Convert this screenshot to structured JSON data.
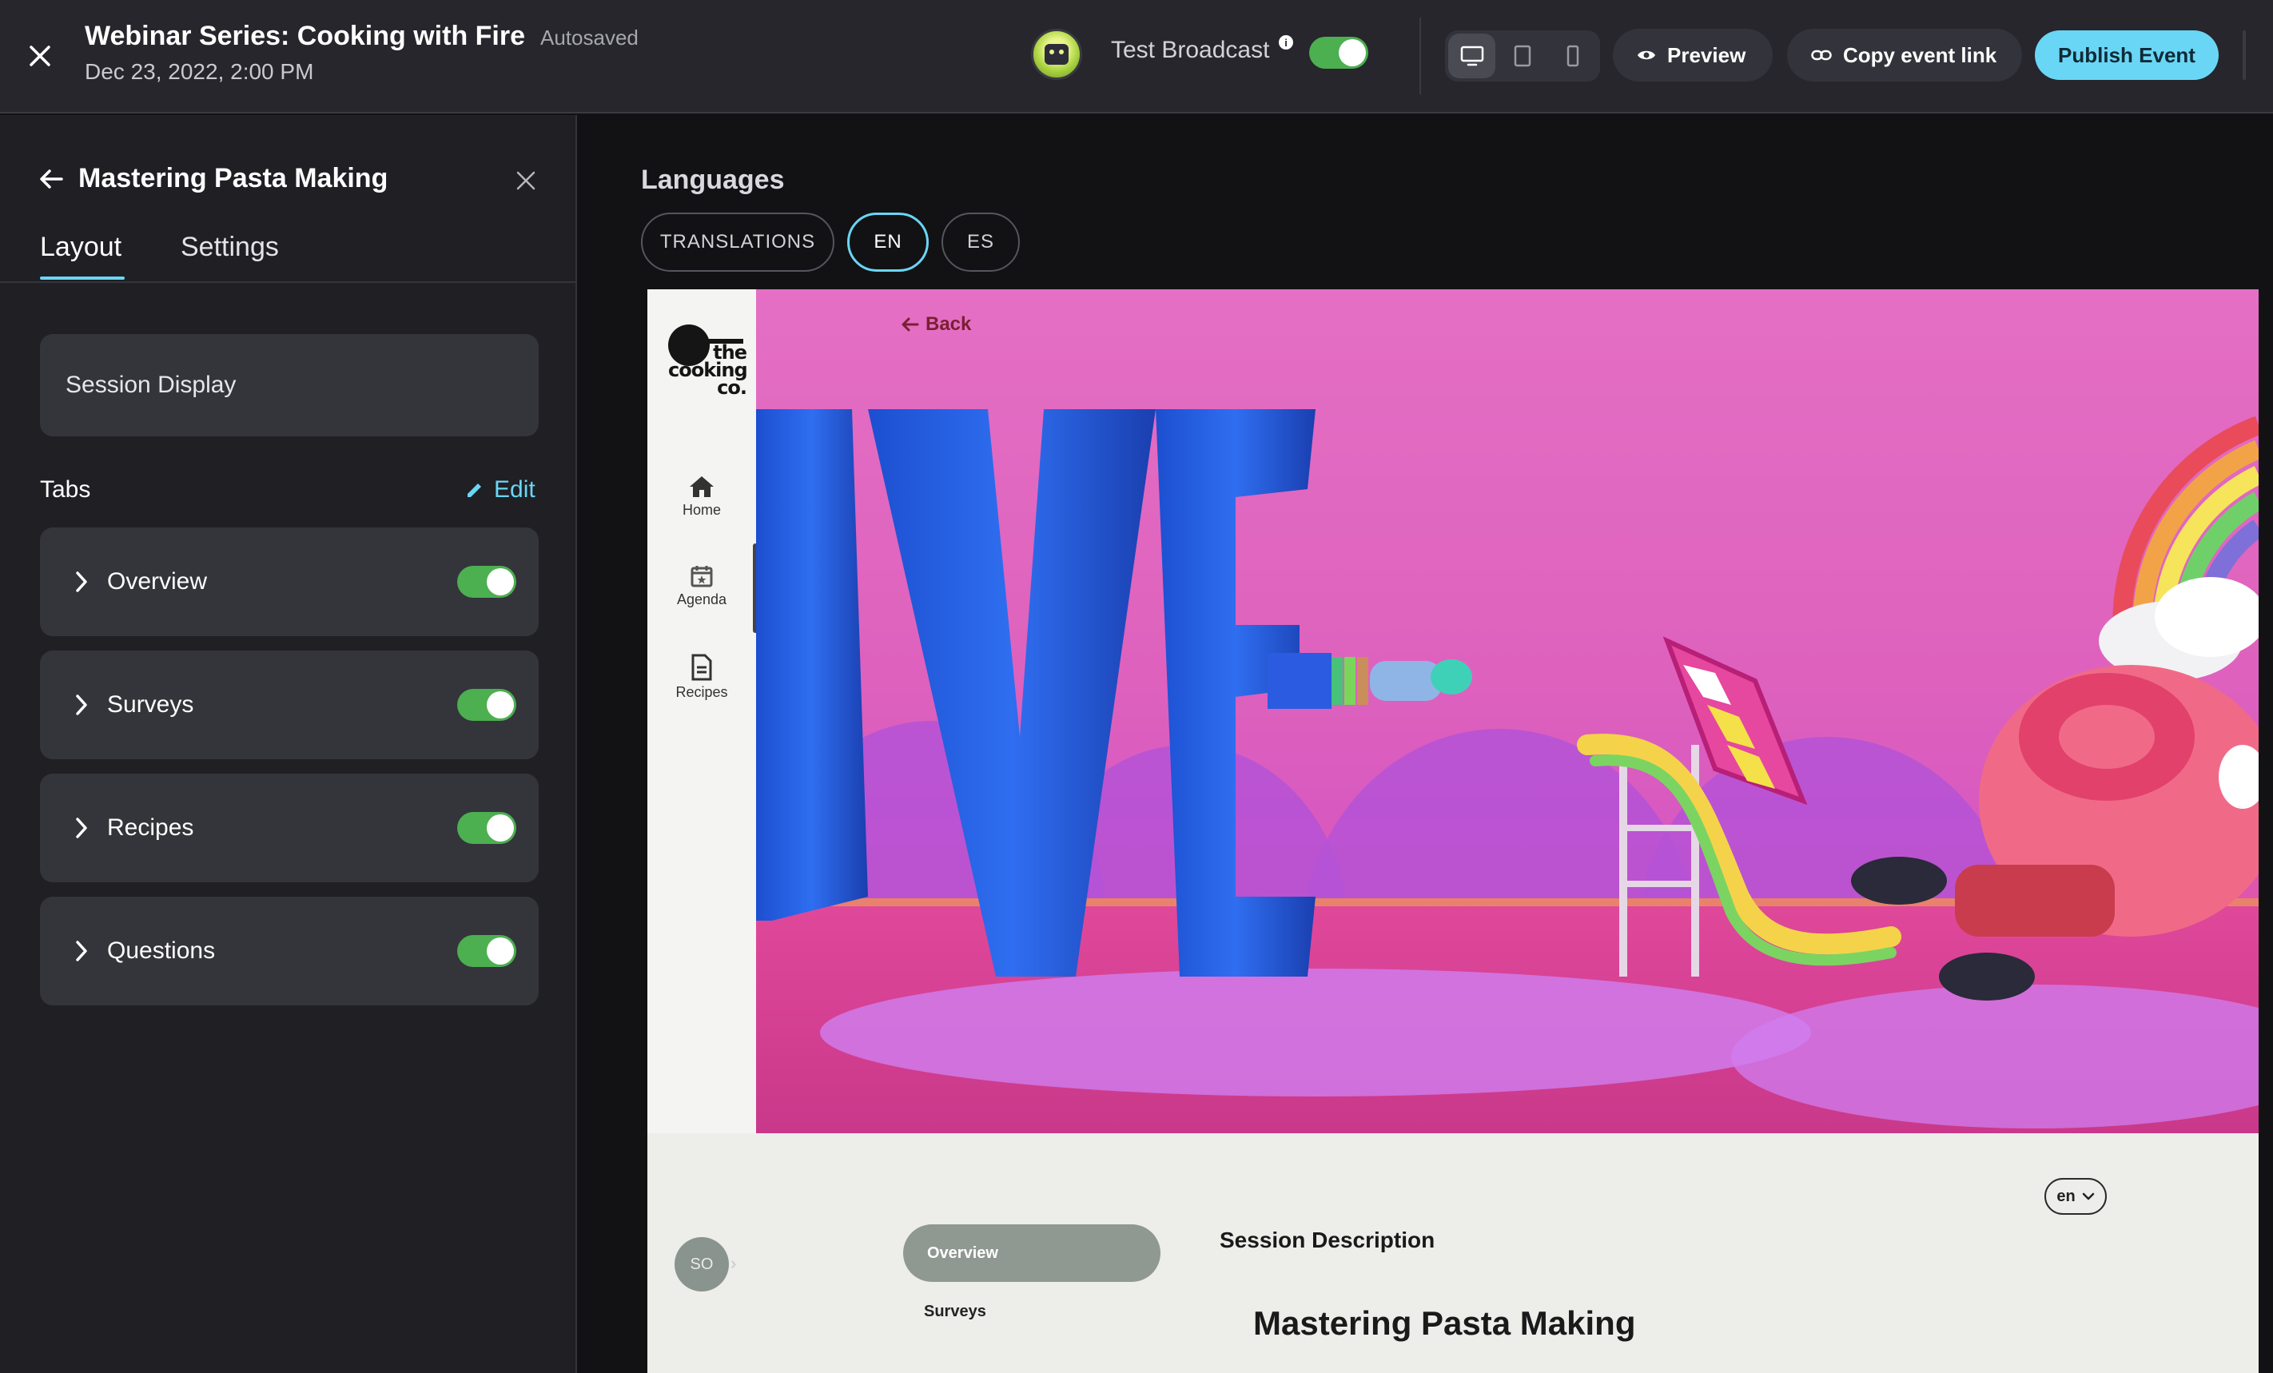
{
  "header": {
    "event_title": "Webinar Series: Cooking with Fire",
    "autosave_status": "Autosaved",
    "event_datetime": "Dec 23, 2022, 2:00 PM",
    "broadcast_label": "Test Broadcast",
    "broadcast_info_glyph": "i",
    "broadcast_enabled": true,
    "device_modes": [
      "desktop",
      "tablet",
      "mobile"
    ],
    "active_device": "desktop",
    "preview_label": "Preview",
    "copy_link_label": "Copy event link",
    "publish_label": "Publish Event"
  },
  "panel": {
    "title": "Mastering Pasta Making",
    "tabs": [
      "Layout",
      "Settings"
    ],
    "active_tab": "Layout",
    "session_display_label": "Session Display",
    "tabs_heading": "Tabs",
    "edit_label": "Edit",
    "tab_items": [
      {
        "label": "Overview",
        "enabled": true
      },
      {
        "label": "Surveys",
        "enabled": true
      },
      {
        "label": "Recipes",
        "enabled": true
      },
      {
        "label": "Questions",
        "enabled": true
      }
    ]
  },
  "languages": {
    "title": "Languages",
    "options": [
      "TRANSLATIONS",
      "EN",
      "ES"
    ],
    "selected": "EN"
  },
  "preview": {
    "logo_text": "the cooking co.",
    "nav": [
      {
        "label": "Home",
        "icon": "home-icon"
      },
      {
        "label": "Agenda",
        "icon": "calendar-icon"
      },
      {
        "label": "Recipes",
        "icon": "document-icon"
      }
    ],
    "back_label": "Back",
    "language_select": "en",
    "speaker_initials": "SO",
    "session_tabs": [
      "Overview",
      "Surveys"
    ],
    "active_session_tab": "Overview",
    "session_description_label": "Session Description",
    "session_name": "Mastering Pasta Making"
  },
  "colors": {
    "accent": "#6ad6f5",
    "toggle_on": "#4caf50",
    "topbar_bg": "#26262c",
    "panel_bg": "#1f1f24",
    "hero_pink": "#de62bd"
  }
}
